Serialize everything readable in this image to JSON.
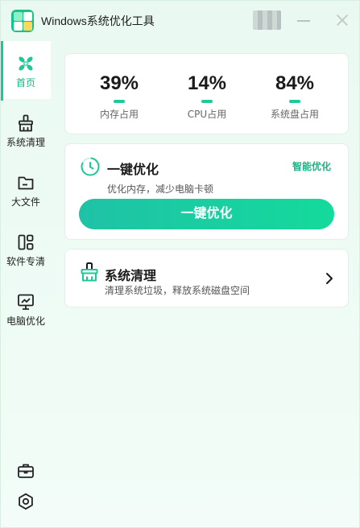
{
  "app": {
    "title": "Windows系统优化工具"
  },
  "sidebar": {
    "items": [
      {
        "label": "首页",
        "icon": "fan-icon",
        "active": true
      },
      {
        "label": "系统清理",
        "icon": "broom-icon"
      },
      {
        "label": "大文件",
        "icon": "folder-icon"
      },
      {
        "label": "软件专清",
        "icon": "apps-icon"
      },
      {
        "label": "电脑优化",
        "icon": "monitor-icon"
      }
    ],
    "tools": [
      "toolbox-icon",
      "settings-icon"
    ]
  },
  "stats": [
    {
      "value": "39%",
      "label": "内存占用"
    },
    {
      "value": "14%",
      "label": "CPU占用"
    },
    {
      "value": "84%",
      "label": "系统盘占用"
    }
  ],
  "optimize": {
    "title": "一键优化",
    "smart_label": "智能优化",
    "description": "优化内存，减少电脑卡顿",
    "button_label": "一键优化"
  },
  "clean": {
    "title": "系统清理",
    "description": "清理系统垃圾，释放系统磁盘空间"
  },
  "colors": {
    "accent": "#1ec797",
    "accent_text": "#18b683",
    "background": "#eefaf4"
  }
}
